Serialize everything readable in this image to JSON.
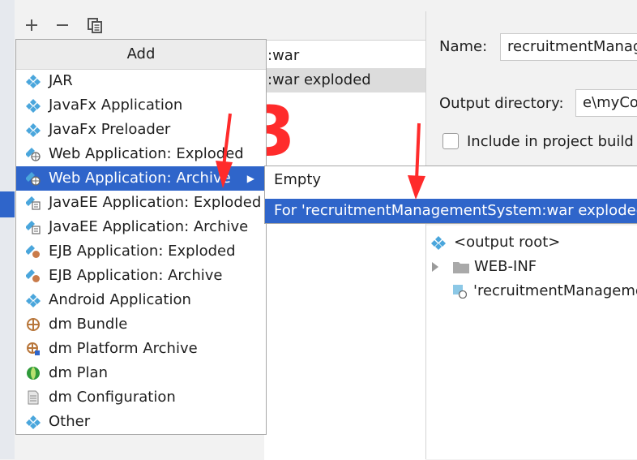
{
  "toolbar": {
    "add_icon": "plus-icon",
    "remove_icon": "minus-icon",
    "copy_icon": "copy-icon"
  },
  "artifact_list": {
    "items": [
      ":war",
      ":war exploded"
    ]
  },
  "name_field": {
    "label": "Name:",
    "value": "recruitmentManag"
  },
  "output_dir": {
    "label": "Output directory:",
    "value": "e\\myCo"
  },
  "include_build": {
    "label": "Include in project build",
    "checked": false
  },
  "add_menu": {
    "header": "Add",
    "items": [
      {
        "label": "JAR",
        "icon": "artifact-icon"
      },
      {
        "label": "JavaFx Application",
        "icon": "artifact-icon"
      },
      {
        "label": "JavaFx Preloader",
        "icon": "artifact-icon"
      },
      {
        "label": "Web Application: Exploded",
        "icon": "web-artifact-icon"
      },
      {
        "label": "Web Application: Archive",
        "icon": "web-artifact-icon",
        "has_submenu": true,
        "selected": true
      },
      {
        "label": "JavaEE Application: Exploded",
        "icon": "javaee-artifact-icon"
      },
      {
        "label": "JavaEE Application: Archive",
        "icon": "javaee-artifact-icon"
      },
      {
        "label": "EJB Application: Exploded",
        "icon": "ejb-artifact-icon"
      },
      {
        "label": "EJB Application: Archive",
        "icon": "ejb-artifact-icon"
      },
      {
        "label": "Android Application",
        "icon": "artifact-icon"
      },
      {
        "label": "dm Bundle",
        "icon": "dm-bundle-icon"
      },
      {
        "label": "dm Platform Archive",
        "icon": "dm-platform-icon"
      },
      {
        "label": "dm Plan",
        "icon": "dm-plan-icon"
      },
      {
        "label": "dm Configuration",
        "icon": "document-icon"
      },
      {
        "label": "Other",
        "icon": "artifact-icon"
      }
    ]
  },
  "sub_menu": {
    "items": [
      {
        "label": "Empty",
        "selected": false
      },
      {
        "label": "For 'recruitmentManagementSystem:war exploded'",
        "selected": true
      }
    ]
  },
  "output_tree": {
    "root": "<output root>",
    "folder": "WEB-INF",
    "artifact": "'recruitmentManageme"
  },
  "annotation": {
    "number": "3",
    "color": "#ff2b2b"
  },
  "colors": {
    "selection": "#2f65ca",
    "annotation": "#ff2b2b"
  }
}
